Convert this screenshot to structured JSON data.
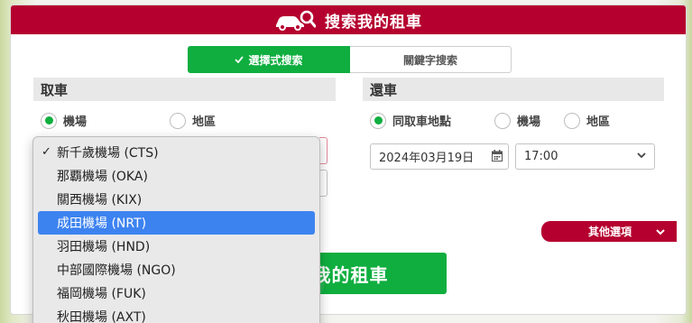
{
  "header": {
    "title": "搜索我的租車",
    "icon": "car-search-icon"
  },
  "tabs": [
    {
      "label": "選擇式搜索",
      "active": true
    },
    {
      "label": "關鍵字搜索",
      "active": false
    }
  ],
  "pickup": {
    "title": "取車",
    "options": [
      {
        "label": "機場",
        "checked": true
      },
      {
        "label": "地區",
        "checked": false
      }
    ]
  },
  "return": {
    "title": "還車",
    "options": [
      {
        "label": "同取車地點",
        "checked": true
      },
      {
        "label": "機場",
        "checked": false
      },
      {
        "label": "地區",
        "checked": false
      }
    ],
    "date": "2024年03月19日",
    "time": "17:00"
  },
  "airport_dropdown": {
    "selected": "新千歲機場 (CTS)",
    "highlighted": "成田機場 (NRT)",
    "options": [
      "新千歲機場 (CTS)",
      "那覇機場 (OKA)",
      "關西機場 (KIX)",
      "成田機場 (NRT)",
      "羽田機場 (HND)",
      "中部國際機場 (NGO)",
      "福岡機場 (FUK)",
      "秋田機場 (AXT)"
    ]
  },
  "more_options": {
    "label": "其他選項"
  },
  "search_button": {
    "label": "搜索我的租車"
  },
  "colors": {
    "brand_red": "#b5002f",
    "brand_green": "#0fae3f",
    "highlight_blue": "#3d83f0"
  }
}
